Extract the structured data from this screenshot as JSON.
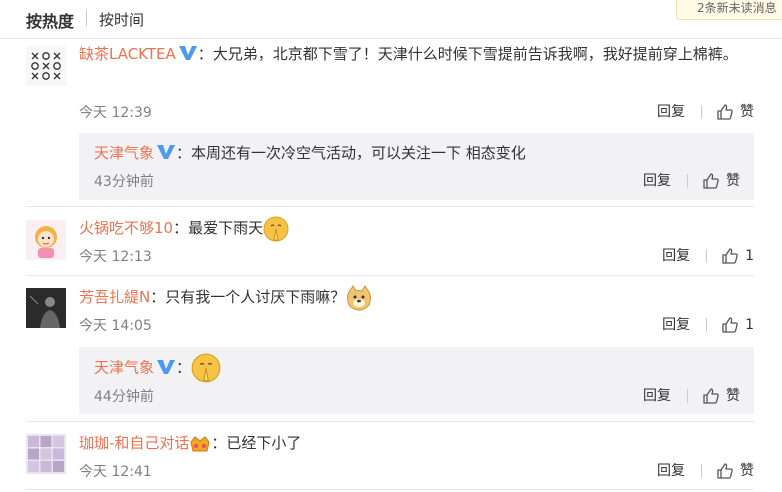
{
  "sort": {
    "hot_label": "按热度",
    "time_label": "按时间"
  },
  "popup": {
    "text": "2条新未读消息"
  },
  "actions": {
    "reply": "回复",
    "like": "赞"
  },
  "comments": [
    {
      "user": "缺茶LACKTEA",
      "text": "：大兄弟，北京都下雪了！天津什么时候下雪提前告诉我啊，我好提前穿上棉裤。",
      "time": "今天 12:39",
      "likes": "赞",
      "reply": {
        "user": "天津气象",
        "text": "：本周还有一次冷空气活动，可以关注一下 相态变化",
        "time": "43分钟前",
        "likes": "赞"
      }
    },
    {
      "user": "火锅吃不够10",
      "text": "：最爱下雨天",
      "time": "今天 12:13",
      "likes": "1",
      "emoji": "pray-emoji"
    },
    {
      "user": "芳吾扎緹N",
      "text": "：只有我一个人讨厌下雨嘛？",
      "time": "今天 14:05",
      "likes": "1",
      "emoji": "doge-emoji",
      "reply": {
        "user": "天津气象",
        "text": "：",
        "time": "44分钟前",
        "likes": "赞",
        "emoji": "pray-emoji"
      }
    },
    {
      "user": "珈珈-和自己对话",
      "text": "：已经下小了",
      "time": "今天 12:41",
      "likes": "赞",
      "emoji": "crown-emoji"
    }
  ]
}
